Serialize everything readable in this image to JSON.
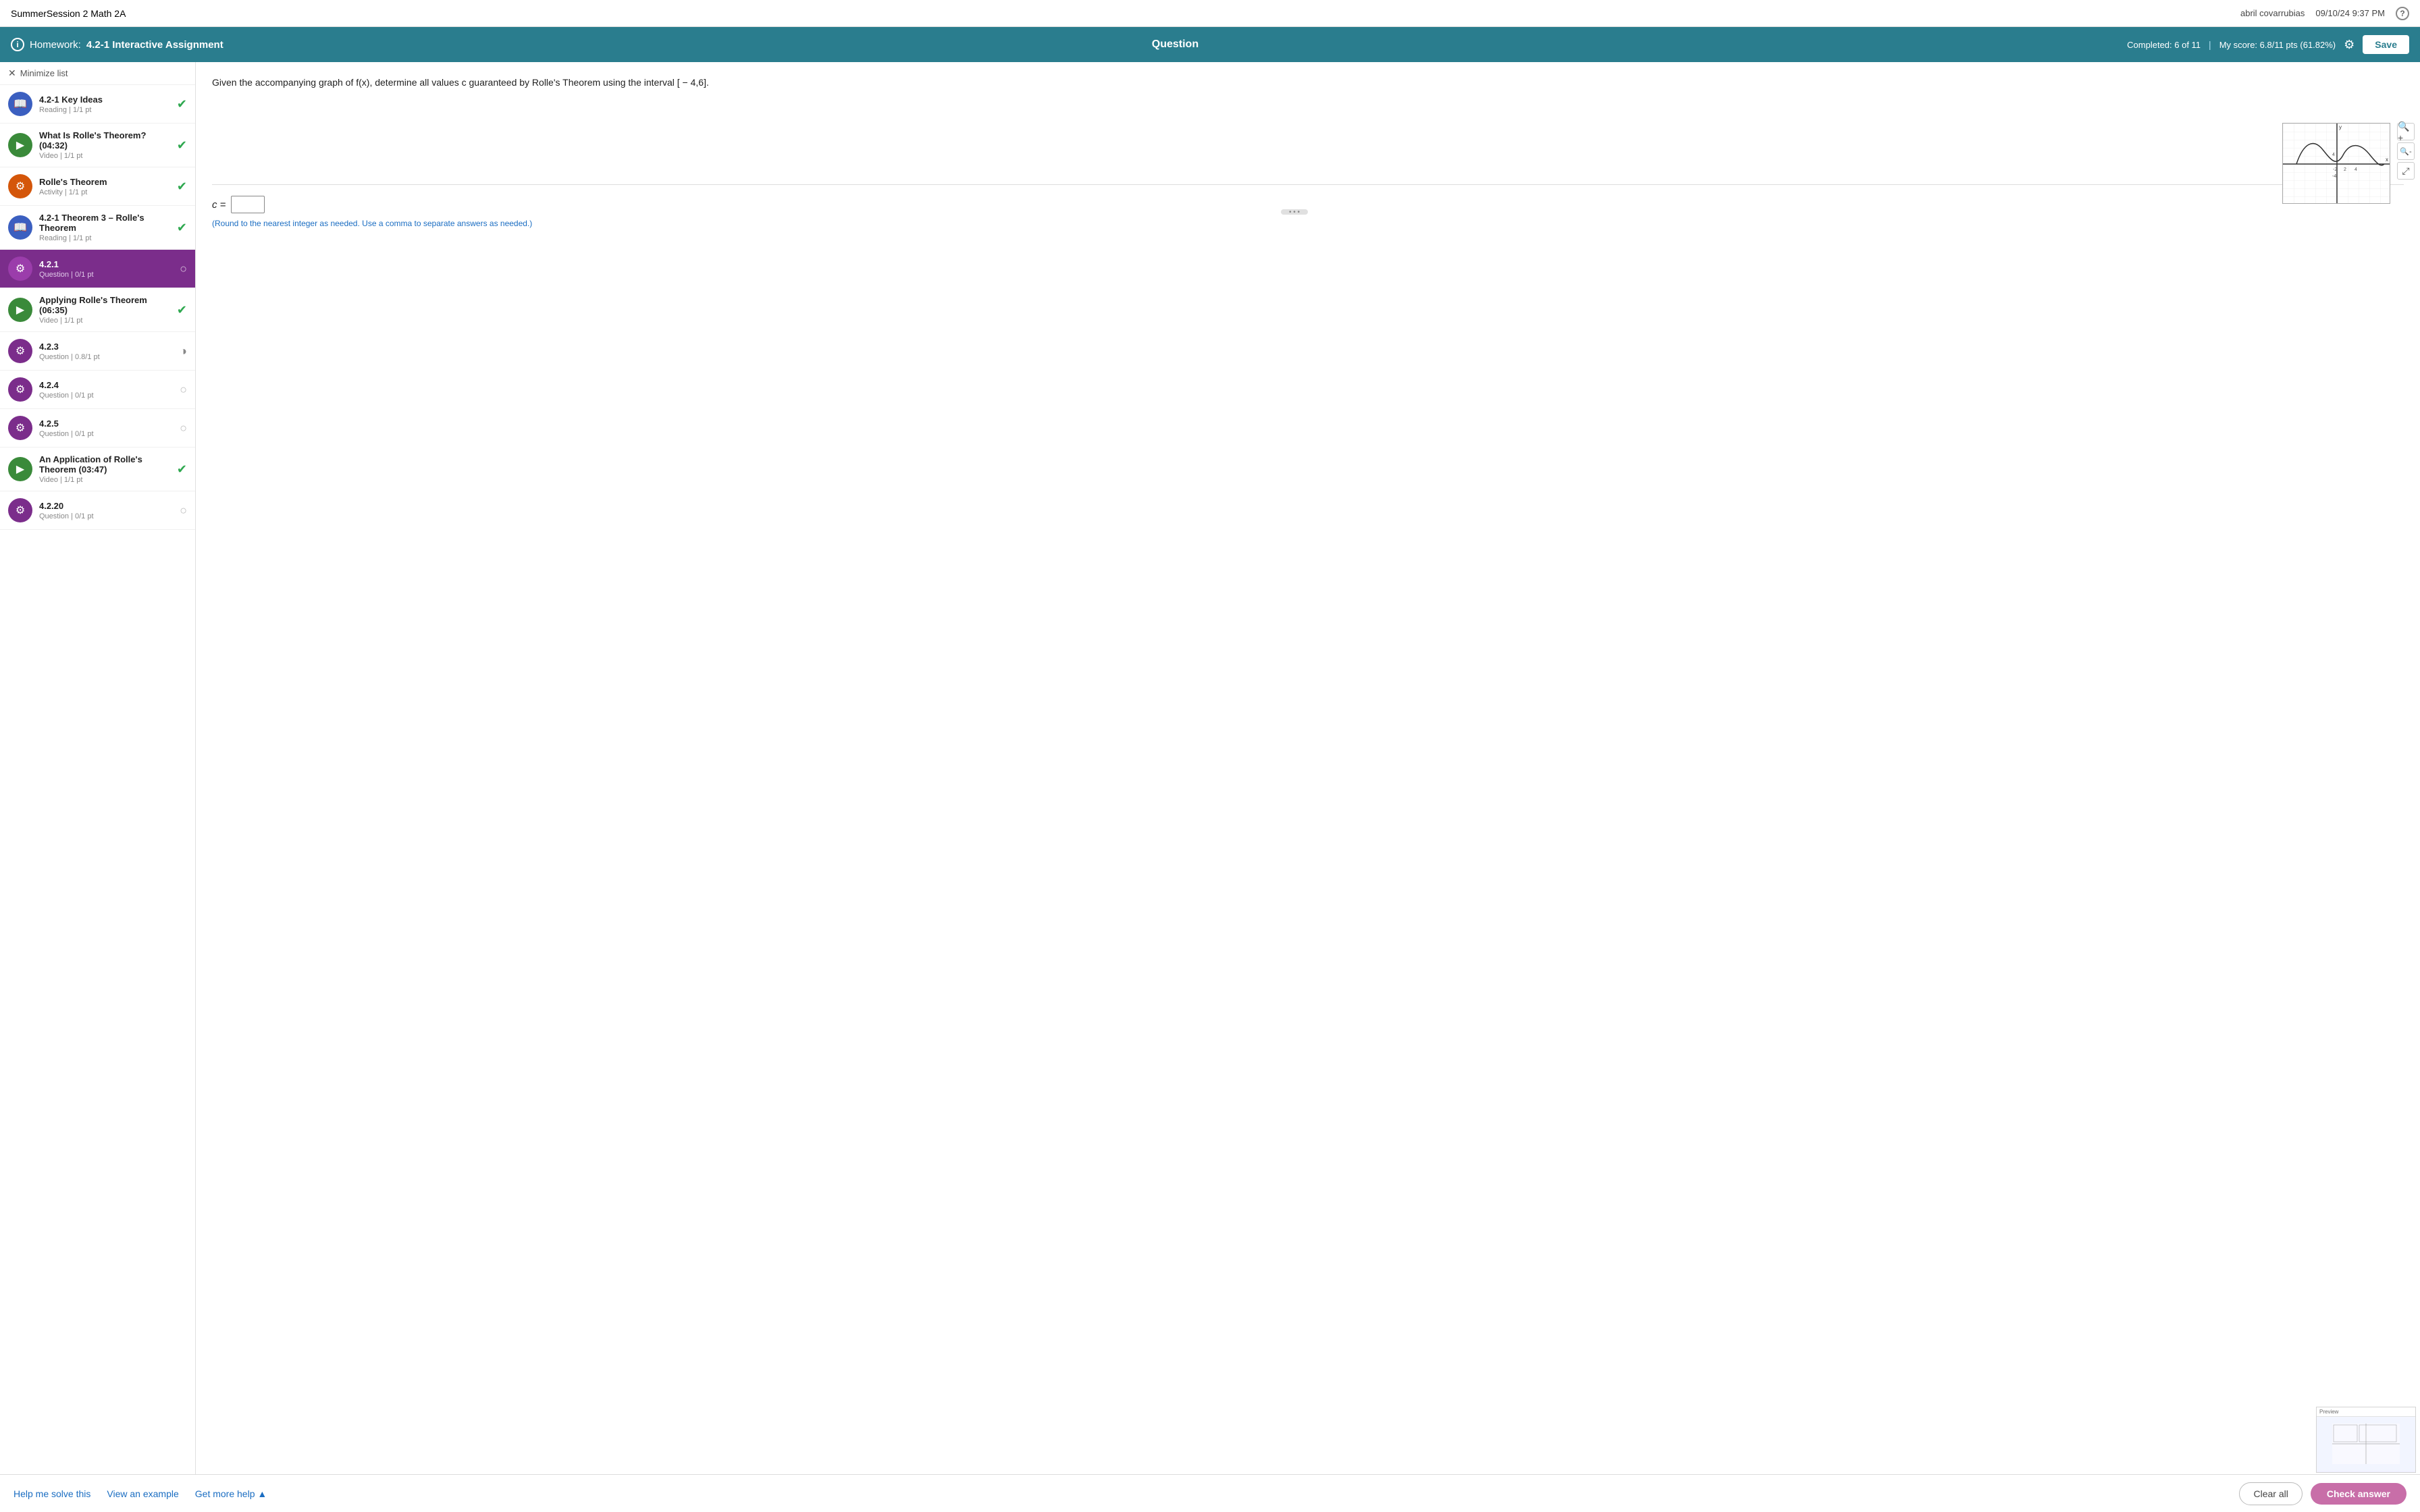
{
  "topBar": {
    "title": "SummerSession 2 Math 2A",
    "user": "abril covarrubias",
    "date": "09/10/24 9:37 PM"
  },
  "header": {
    "info_icon": "ℹ",
    "hw_label": "Homework:",
    "hw_name": "4.2-1 Interactive Assignment",
    "center_label": "Question",
    "completed_text": "Completed: 6 of 11",
    "score_text": "My score: 6.8/11 pts (61.82%)",
    "save_label": "Save"
  },
  "sidebar": {
    "minimize_label": "Minimize list",
    "items": [
      {
        "id": "item-1",
        "title": "4.2-1 Key Ideas",
        "subtitle": "Reading  |  1/1 pt",
        "icon_type": "book",
        "icon_color": "blue",
        "status": "check"
      },
      {
        "id": "item-2",
        "title": "What Is Rolle's Theorem? (04:32)",
        "subtitle": "Video  |  1/1 pt",
        "icon_type": "video",
        "icon_color": "green",
        "status": "check"
      },
      {
        "id": "item-3",
        "title": "Rolle's Theorem",
        "subtitle": "Activity  |  1/1 pt",
        "icon_type": "activity",
        "icon_color": "orange",
        "status": "check"
      },
      {
        "id": "item-4",
        "title": "4.2-1 Theorem 3 – Rolle's Theorem",
        "subtitle": "Reading  |  1/1 pt",
        "icon_type": "book",
        "icon_color": "blue",
        "status": "check"
      },
      {
        "id": "item-5",
        "title": "4.2.1",
        "subtitle": "Question  |  0/1 pt",
        "icon_type": "gear",
        "icon_color": "purple",
        "status": "empty-white",
        "active": true
      },
      {
        "id": "item-6",
        "title": "Applying Rolle's Theorem (06:35)",
        "subtitle": "Video  |  1/1 pt",
        "icon_type": "video",
        "icon_color": "green",
        "status": "check"
      },
      {
        "id": "item-7",
        "title": "4.2.3",
        "subtitle": "Question  |  0.8/1 pt",
        "icon_type": "gear",
        "icon_color": "purple",
        "status": "half"
      },
      {
        "id": "item-8",
        "title": "4.2.4",
        "subtitle": "Question  |  0/1 pt",
        "icon_type": "gear",
        "icon_color": "purple",
        "status": "empty"
      },
      {
        "id": "item-9",
        "title": "4.2.5",
        "subtitle": "Question  |  0/1 pt",
        "icon_type": "gear",
        "icon_color": "purple",
        "status": "empty"
      },
      {
        "id": "item-10",
        "title": "An Application of Rolle's Theorem (03:47)",
        "subtitle": "Video  |  1/1 pt",
        "icon_type": "video",
        "icon_color": "green",
        "status": "check"
      },
      {
        "id": "item-11",
        "title": "4.2.20",
        "subtitle": "Question  |  0/1 pt",
        "icon_type": "gear",
        "icon_color": "purple",
        "status": "empty"
      }
    ]
  },
  "content": {
    "question_text": "Given the accompanying graph of f(x), determine all values c guaranteed by Rolle's Theorem using the interval [ − 4,6].",
    "c_label": "c =",
    "answer_hint": "(Round to the nearest integer as needed. Use a comma to separate answers as needed.)",
    "answer_value": ""
  },
  "bottomBar": {
    "help_me_solve": "Help me solve this",
    "view_example": "View an example",
    "get_more_help": "Get more help ▲",
    "clear_all": "Clear all",
    "check_answer": "Check answer"
  }
}
